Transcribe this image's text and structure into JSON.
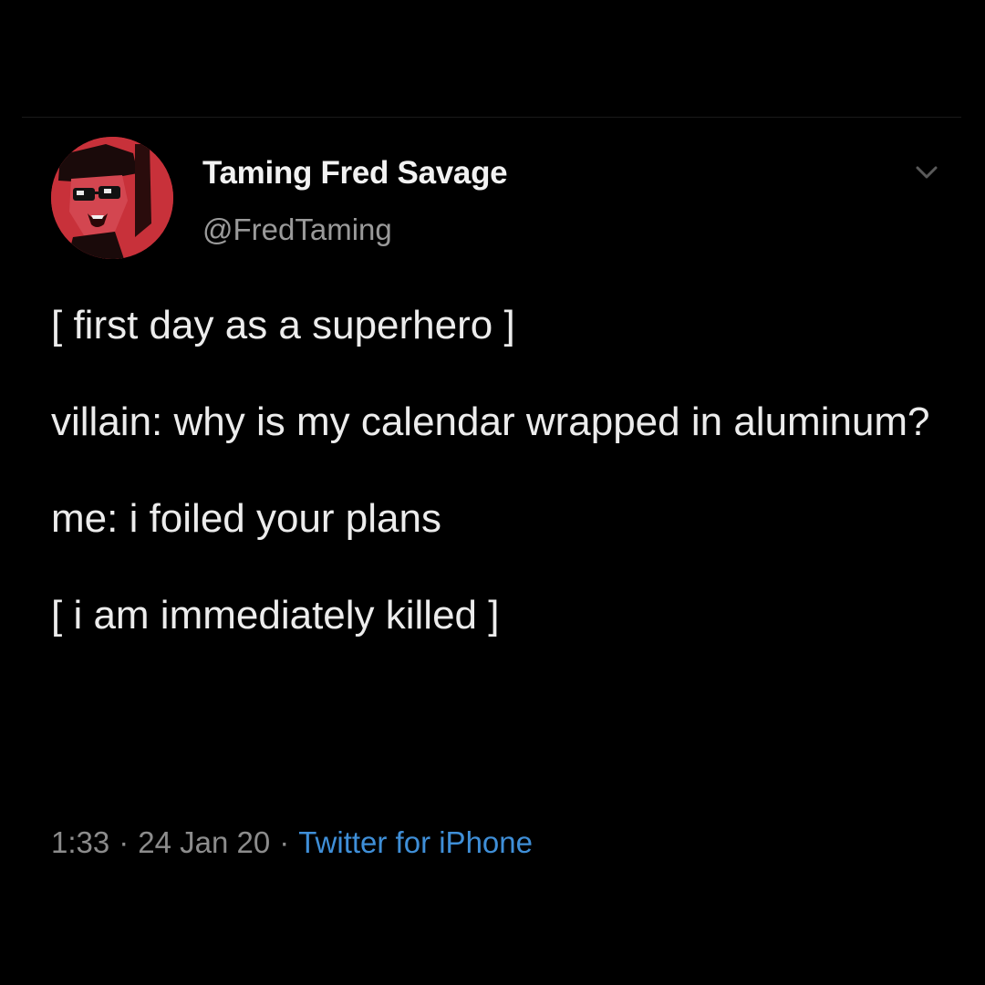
{
  "tweet": {
    "author": {
      "display_name": "Taming Fred Savage",
      "handle": "@FredTaming"
    },
    "paragraphs": [
      "[ first day as a superhero ]",
      "villain: why is my calendar wrapped in aluminum?",
      "me: i foiled your plans",
      "[ i am immediately killed ]"
    ],
    "meta": {
      "time": "1:33",
      "separator": "·",
      "date": "24 Jan 20",
      "source": "Twitter for iPhone"
    }
  },
  "icons": {
    "menu": "chevron-down-icon",
    "avatar": "profile-avatar"
  },
  "colors": {
    "background": "#000000",
    "text_primary": "#ececec",
    "text_secondary": "#9a9a9a",
    "link": "#3f8fd8",
    "avatar_red": "#c8313a"
  }
}
